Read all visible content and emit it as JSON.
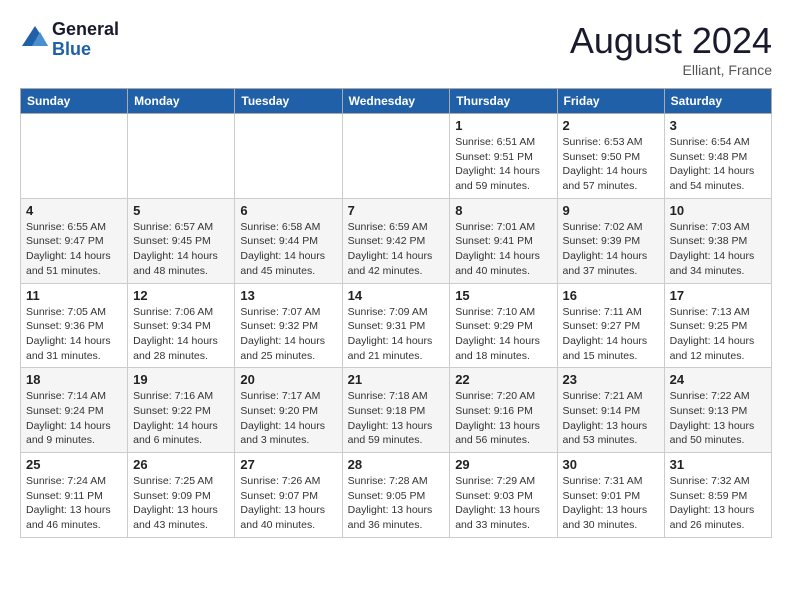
{
  "header": {
    "logo_line1": "General",
    "logo_line2": "Blue",
    "month_year": "August 2024",
    "location": "Elliant, France"
  },
  "weekdays": [
    "Sunday",
    "Monday",
    "Tuesday",
    "Wednesday",
    "Thursday",
    "Friday",
    "Saturday"
  ],
  "weeks": [
    [
      {
        "day": "",
        "info": ""
      },
      {
        "day": "",
        "info": ""
      },
      {
        "day": "",
        "info": ""
      },
      {
        "day": "",
        "info": ""
      },
      {
        "day": "1",
        "info": "Sunrise: 6:51 AM\nSunset: 9:51 PM\nDaylight: 14 hours\nand 59 minutes."
      },
      {
        "day": "2",
        "info": "Sunrise: 6:53 AM\nSunset: 9:50 PM\nDaylight: 14 hours\nand 57 minutes."
      },
      {
        "day": "3",
        "info": "Sunrise: 6:54 AM\nSunset: 9:48 PM\nDaylight: 14 hours\nand 54 minutes."
      }
    ],
    [
      {
        "day": "4",
        "info": "Sunrise: 6:55 AM\nSunset: 9:47 PM\nDaylight: 14 hours\nand 51 minutes."
      },
      {
        "day": "5",
        "info": "Sunrise: 6:57 AM\nSunset: 9:45 PM\nDaylight: 14 hours\nand 48 minutes."
      },
      {
        "day": "6",
        "info": "Sunrise: 6:58 AM\nSunset: 9:44 PM\nDaylight: 14 hours\nand 45 minutes."
      },
      {
        "day": "7",
        "info": "Sunrise: 6:59 AM\nSunset: 9:42 PM\nDaylight: 14 hours\nand 42 minutes."
      },
      {
        "day": "8",
        "info": "Sunrise: 7:01 AM\nSunset: 9:41 PM\nDaylight: 14 hours\nand 40 minutes."
      },
      {
        "day": "9",
        "info": "Sunrise: 7:02 AM\nSunset: 9:39 PM\nDaylight: 14 hours\nand 37 minutes."
      },
      {
        "day": "10",
        "info": "Sunrise: 7:03 AM\nSunset: 9:38 PM\nDaylight: 14 hours\nand 34 minutes."
      }
    ],
    [
      {
        "day": "11",
        "info": "Sunrise: 7:05 AM\nSunset: 9:36 PM\nDaylight: 14 hours\nand 31 minutes."
      },
      {
        "day": "12",
        "info": "Sunrise: 7:06 AM\nSunset: 9:34 PM\nDaylight: 14 hours\nand 28 minutes."
      },
      {
        "day": "13",
        "info": "Sunrise: 7:07 AM\nSunset: 9:32 PM\nDaylight: 14 hours\nand 25 minutes."
      },
      {
        "day": "14",
        "info": "Sunrise: 7:09 AM\nSunset: 9:31 PM\nDaylight: 14 hours\nand 21 minutes."
      },
      {
        "day": "15",
        "info": "Sunrise: 7:10 AM\nSunset: 9:29 PM\nDaylight: 14 hours\nand 18 minutes."
      },
      {
        "day": "16",
        "info": "Sunrise: 7:11 AM\nSunset: 9:27 PM\nDaylight: 14 hours\nand 15 minutes."
      },
      {
        "day": "17",
        "info": "Sunrise: 7:13 AM\nSunset: 9:25 PM\nDaylight: 14 hours\nand 12 minutes."
      }
    ],
    [
      {
        "day": "18",
        "info": "Sunrise: 7:14 AM\nSunset: 9:24 PM\nDaylight: 14 hours\nand 9 minutes."
      },
      {
        "day": "19",
        "info": "Sunrise: 7:16 AM\nSunset: 9:22 PM\nDaylight: 14 hours\nand 6 minutes."
      },
      {
        "day": "20",
        "info": "Sunrise: 7:17 AM\nSunset: 9:20 PM\nDaylight: 14 hours\nand 3 minutes."
      },
      {
        "day": "21",
        "info": "Sunrise: 7:18 AM\nSunset: 9:18 PM\nDaylight: 13 hours\nand 59 minutes."
      },
      {
        "day": "22",
        "info": "Sunrise: 7:20 AM\nSunset: 9:16 PM\nDaylight: 13 hours\nand 56 minutes."
      },
      {
        "day": "23",
        "info": "Sunrise: 7:21 AM\nSunset: 9:14 PM\nDaylight: 13 hours\nand 53 minutes."
      },
      {
        "day": "24",
        "info": "Sunrise: 7:22 AM\nSunset: 9:13 PM\nDaylight: 13 hours\nand 50 minutes."
      }
    ],
    [
      {
        "day": "25",
        "info": "Sunrise: 7:24 AM\nSunset: 9:11 PM\nDaylight: 13 hours\nand 46 minutes."
      },
      {
        "day": "26",
        "info": "Sunrise: 7:25 AM\nSunset: 9:09 PM\nDaylight: 13 hours\nand 43 minutes."
      },
      {
        "day": "27",
        "info": "Sunrise: 7:26 AM\nSunset: 9:07 PM\nDaylight: 13 hours\nand 40 minutes."
      },
      {
        "day": "28",
        "info": "Sunrise: 7:28 AM\nSunset: 9:05 PM\nDaylight: 13 hours\nand 36 minutes."
      },
      {
        "day": "29",
        "info": "Sunrise: 7:29 AM\nSunset: 9:03 PM\nDaylight: 13 hours\nand 33 minutes."
      },
      {
        "day": "30",
        "info": "Sunrise: 7:31 AM\nSunset: 9:01 PM\nDaylight: 13 hours\nand 30 minutes."
      },
      {
        "day": "31",
        "info": "Sunrise: 7:32 AM\nSunset: 8:59 PM\nDaylight: 13 hours\nand 26 minutes."
      }
    ]
  ]
}
